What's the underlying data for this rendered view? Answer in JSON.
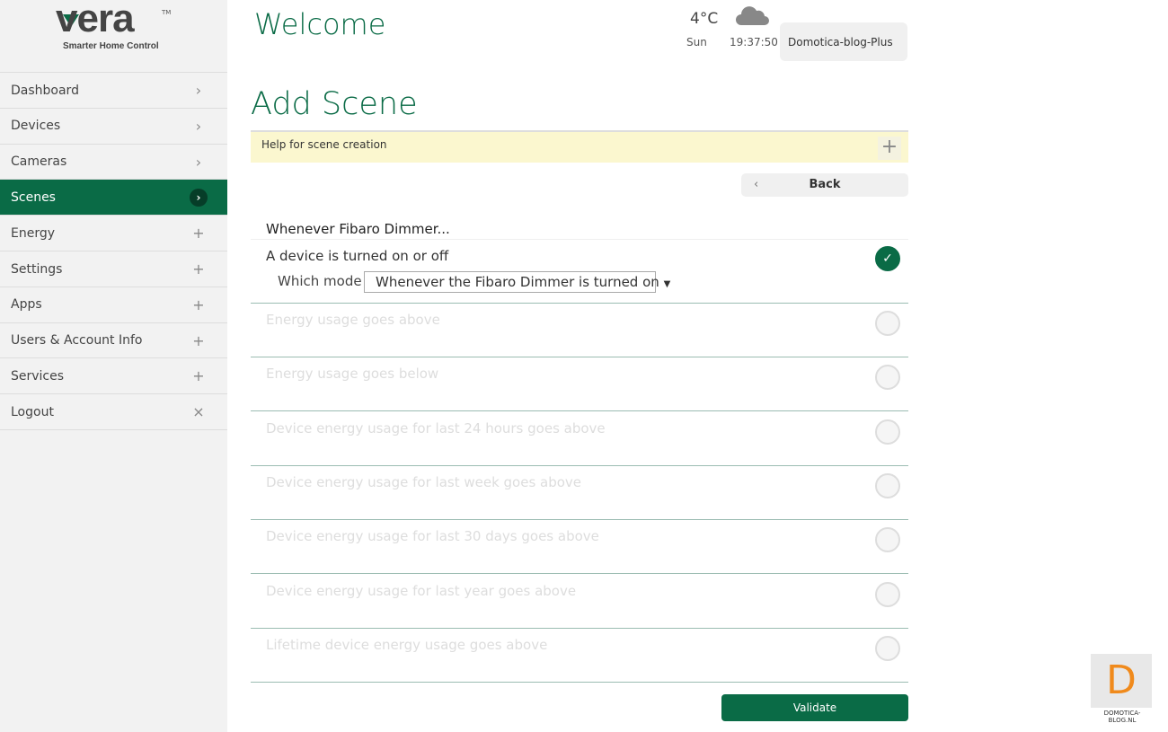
{
  "logo": {
    "word": "vera",
    "tm": "TM",
    "tagline": "Smarter Home Control"
  },
  "sidebar": {
    "items": [
      {
        "label": "Dashboard",
        "icon": "›"
      },
      {
        "label": "Devices",
        "icon": "›"
      },
      {
        "label": "Cameras",
        "icon": "›"
      },
      {
        "label": "Scenes",
        "icon": "›"
      },
      {
        "label": "Energy",
        "icon": "+"
      },
      {
        "label": "Settings",
        "icon": "+"
      },
      {
        "label": "Apps",
        "icon": "+"
      },
      {
        "label": "Users & Account Info",
        "icon": "+"
      },
      {
        "label": "Services",
        "icon": "+"
      },
      {
        "label": "Logout",
        "icon": "×"
      }
    ]
  },
  "header": {
    "welcome": "Welcome",
    "temperature": "4°C",
    "day": "Sun",
    "time": "19:37:50",
    "user": "Domotica-blog-Plus"
  },
  "page": {
    "title": "Add Scene",
    "help": "Help for scene creation",
    "back": "Back",
    "trigger_title": "Whenever Fibaro Dimmer...",
    "mode_label": "Which mode",
    "mode_value": "Whenever the Fibaro Dimmer is turned on",
    "options": [
      "A device is turned on or off",
      "Energy usage goes above",
      "Energy usage goes below",
      "Device energy usage for last 24 hours goes above",
      "Device energy usage for last week goes above",
      "Device energy usage for last 30 days goes above",
      "Device energy usage for last year goes above",
      "Lifetime device energy usage goes above"
    ],
    "selected_index": 0,
    "validate": "Validate"
  },
  "watermark": {
    "letter": "D",
    "text": "DOMOTICA-BLOG.NL"
  },
  "colors": {
    "brand": "#0a6b46",
    "help_bg": "#fbf7cf"
  }
}
